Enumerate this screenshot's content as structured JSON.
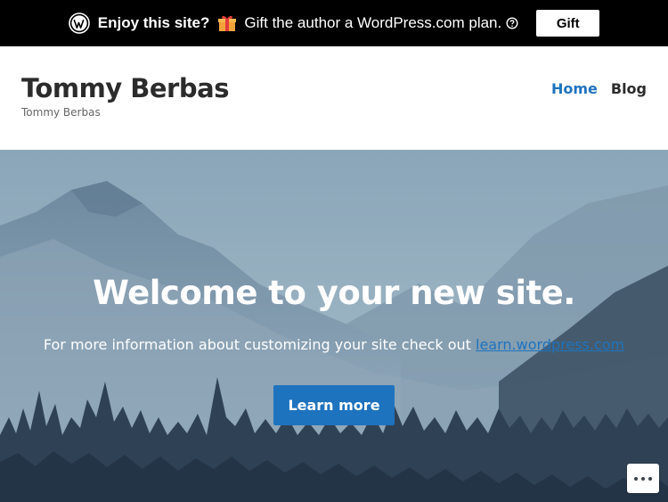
{
  "banner": {
    "enjoy_text": "Enjoy this site?",
    "gift_text": "Gift the author a WordPress.com plan.",
    "gift_button_label": "Gift",
    "icons": [
      "wordpress-logo-icon",
      "gift-emoji-icon",
      "help-icon"
    ]
  },
  "header": {
    "site_title": "Tommy Berbas",
    "tagline": "Tommy Berbas",
    "nav": [
      {
        "label": "Home",
        "active": true
      },
      {
        "label": "Blog",
        "active": false
      }
    ]
  },
  "hero": {
    "title": "Welcome to your new site.",
    "subtitle_prefix": "For more information about customizing your site check out ",
    "subtitle_link": "learn.wordpress.com",
    "button_label": "Learn more"
  },
  "more_actions_icon": "ellipsis-icon",
  "colors": {
    "accent": "#1e73be",
    "banner_bg": "#000000",
    "title_text": "#2b2b2b"
  }
}
